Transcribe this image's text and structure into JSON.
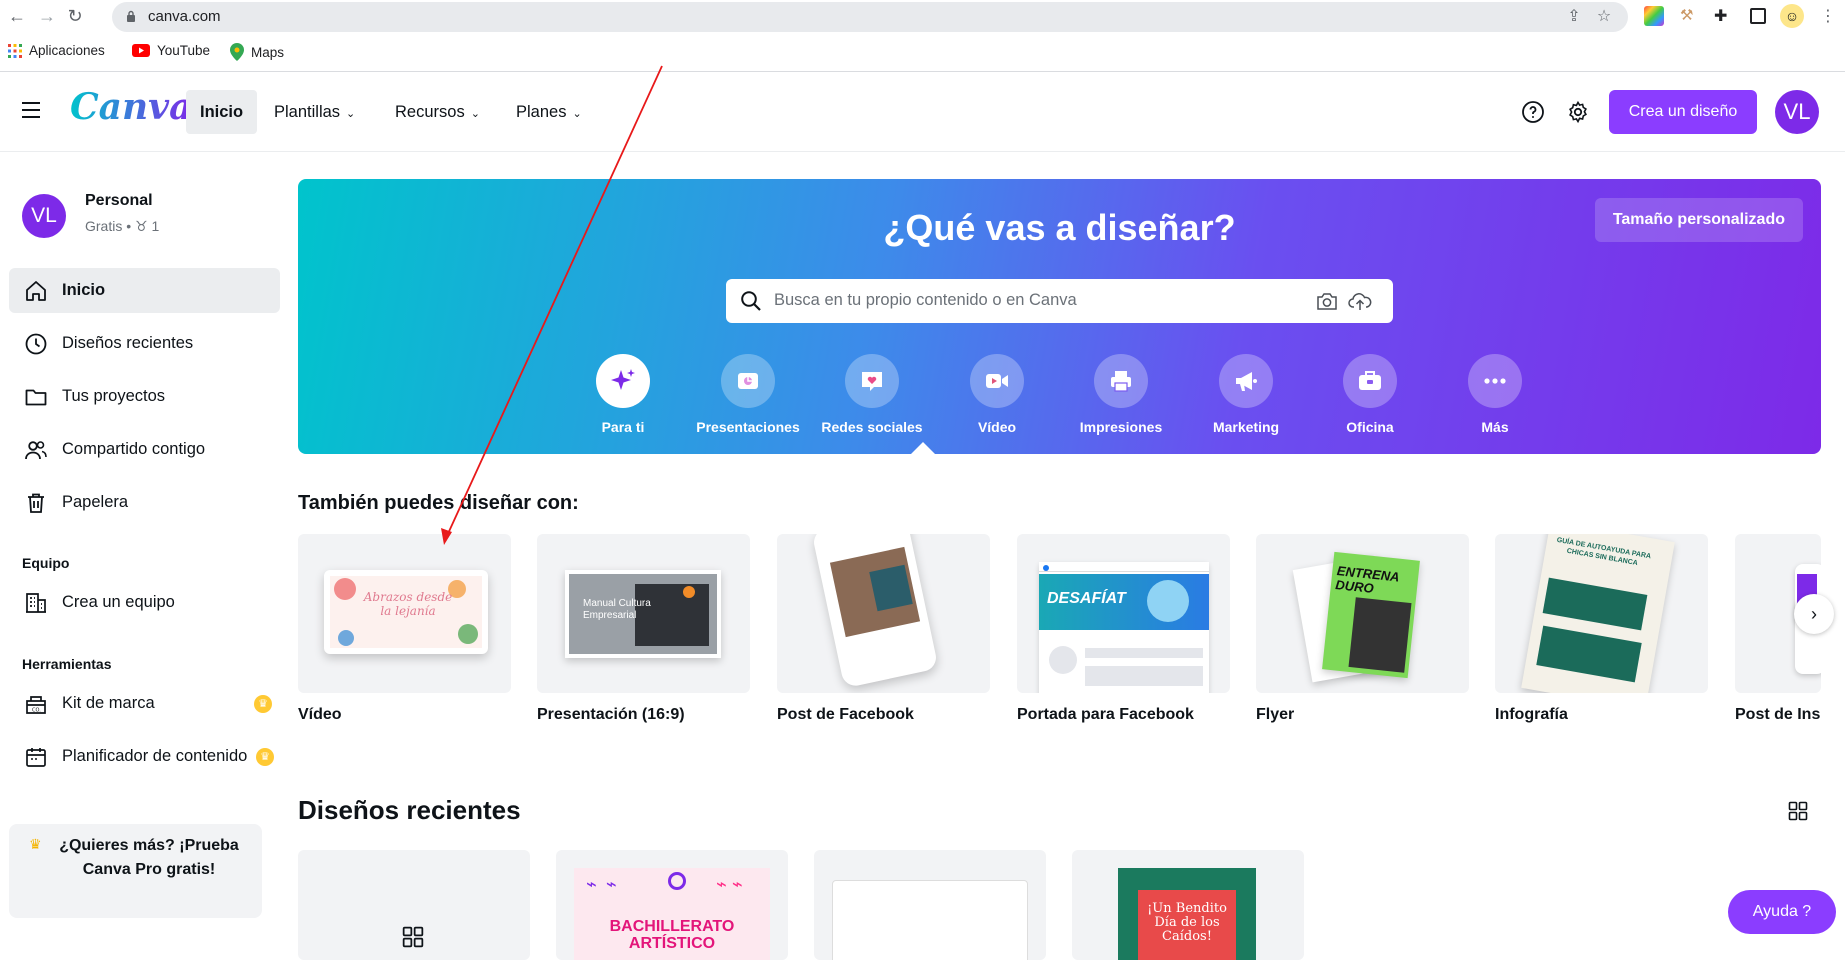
{
  "browser": {
    "url": "canva.com",
    "bookmarks": [
      "Aplicaciones",
      "YouTube",
      "Maps"
    ]
  },
  "header": {
    "logo": "Canva",
    "nav": [
      {
        "label": "Inicio"
      },
      {
        "label": "Plantillas"
      },
      {
        "label": "Recursos"
      },
      {
        "label": "Planes"
      }
    ],
    "create_label": "Crea un diseño",
    "avatar_initials": "VL"
  },
  "sidebar": {
    "team": {
      "initials": "VL",
      "name": "Personal",
      "meta": "Gratis • ♉ 1"
    },
    "items": [
      {
        "label": "Inicio"
      },
      {
        "label": "Diseños recientes"
      },
      {
        "label": "Tus proyectos"
      },
      {
        "label": "Compartido contigo"
      },
      {
        "label": "Papelera"
      }
    ],
    "team_section": "Equipo",
    "team_items": [
      {
        "label": "Crea un equipo"
      }
    ],
    "tools_section": "Herramientas",
    "tools_items": [
      {
        "label": "Kit de marca"
      },
      {
        "label": "Planificador de contenido"
      }
    ],
    "promo": "¿Quieres más? ¡Prueba Canva Pro gratis!"
  },
  "hero": {
    "title": "¿Qué vas a diseñar?",
    "custom_size": "Tamaño personalizado",
    "search_placeholder": "Busca en tu propio contenido o en Canva",
    "categories": [
      {
        "label": "Para ti",
        "icon": "sparkle-icon"
      },
      {
        "label": "Presentaciones",
        "icon": "presentation-icon"
      },
      {
        "label": "Redes sociales",
        "icon": "heart-chat-icon"
      },
      {
        "label": "Vídeo",
        "icon": "video-camera-icon"
      },
      {
        "label": "Impresiones",
        "icon": "printer-icon"
      },
      {
        "label": "Marketing",
        "icon": "megaphone-icon"
      },
      {
        "label": "Oficina",
        "icon": "briefcase-icon"
      },
      {
        "label": "Más",
        "icon": "more-icon"
      }
    ]
  },
  "also_design": {
    "title": "También puedes diseñar con:",
    "cards": [
      {
        "label": "Vídeo",
        "thumb_text": "Abrazos desde la lejanía"
      },
      {
        "label": "Presentación (16:9)",
        "thumb_text": "Manual Cultura Empresarial"
      },
      {
        "label": "Post de Facebook"
      },
      {
        "label": "Portada para Facebook",
        "thumb_text": "DESAFÍAT"
      },
      {
        "label": "Flyer",
        "thumb_text": "ENTRENA DURO"
      },
      {
        "label": "Infografía",
        "thumb_text": "GUÍA DE AUTOAYUDA PARA CHICAS SIN BLANCA"
      },
      {
        "label": "Post de Ins"
      }
    ]
  },
  "recent": {
    "title": "Diseños recientes",
    "items": [
      {
        "thumb_text": ""
      },
      {
        "thumb_text": "BACHILLERATO ARTÍSTICO"
      },
      {
        "thumb_text": ""
      },
      {
        "thumb_text": "¡Un Bendito Día de los Caídos!"
      }
    ]
  },
  "help_label": "Ayuda ?",
  "colors": {
    "brand_purple": "#8b3dff",
    "hero_start": "#00c4cc",
    "hero_end": "#7d2ae8",
    "annotation": "#e8191a"
  }
}
